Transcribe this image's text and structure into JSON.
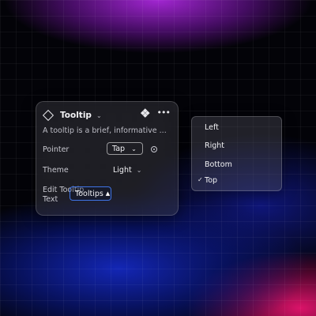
{
  "panel": {
    "title": "Tooltip",
    "description": "A tooltip is a brief, informative ...",
    "icons": [
      "diamond-icon",
      "chevron-down-icon",
      "component-icon",
      "more-icon"
    ],
    "pointer": {
      "label": "Pointer",
      "value": "Tap"
    },
    "theme": {
      "label": "Theme",
      "value": "Light"
    },
    "edit_text": {
      "label_line1": "Edit Tooltip",
      "label_line2": "Text",
      "value": "Tooltips"
    }
  },
  "dropdown": {
    "options": [
      "Left",
      "Right",
      "Bottom",
      "Top"
    ],
    "selected": "Top"
  },
  "colors": {
    "focus_border": "#3f74e6"
  }
}
